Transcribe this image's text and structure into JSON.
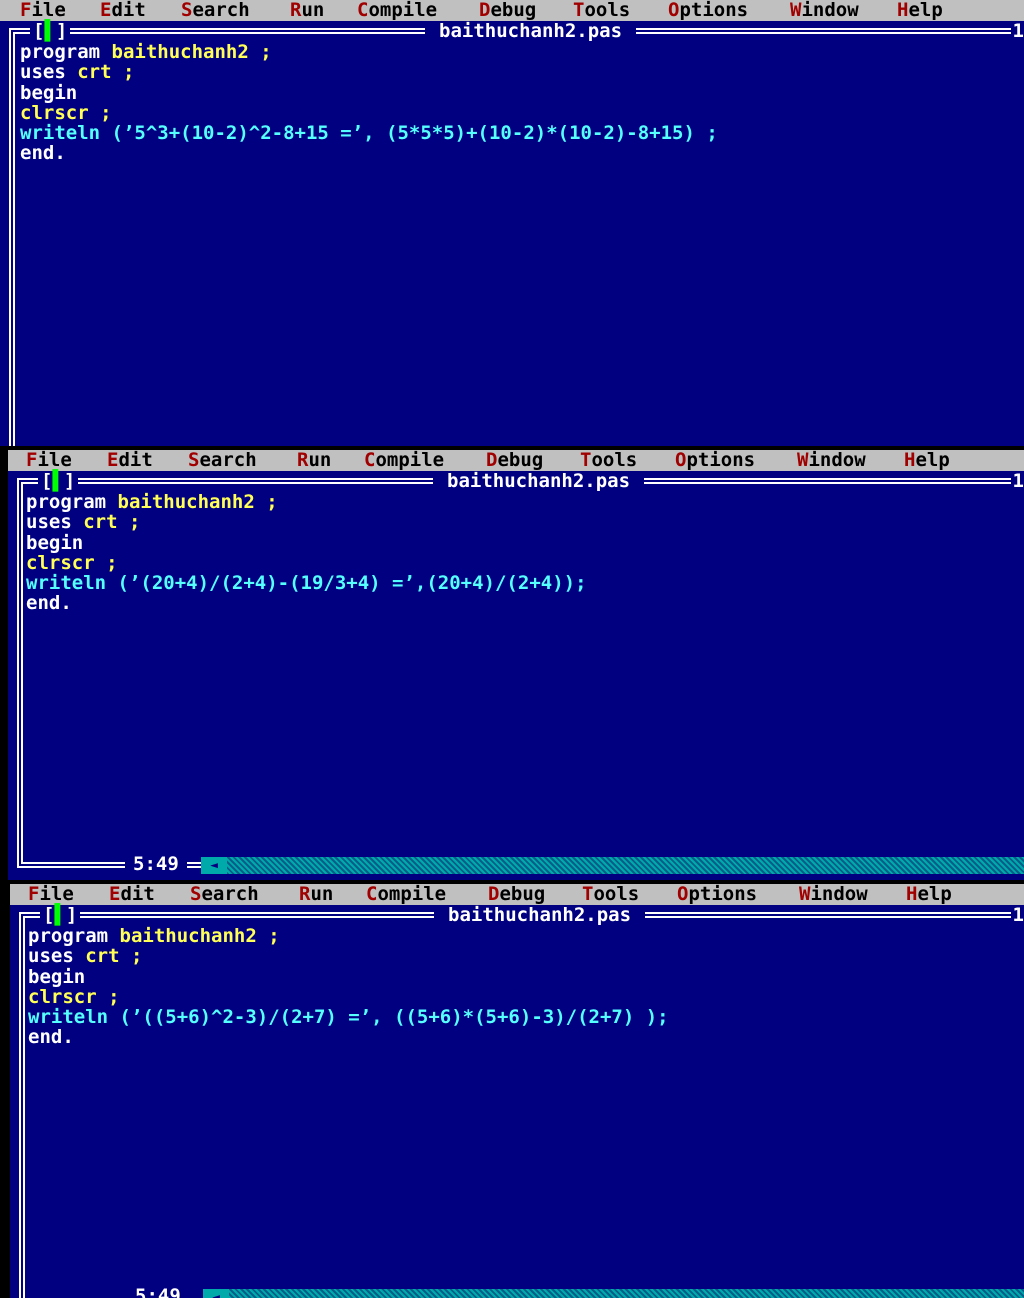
{
  "menu": [
    "File",
    "Edit",
    "Search",
    "Run",
    "Compile",
    "Debug",
    "Tools",
    "Options",
    "Window",
    "Help"
  ],
  "window": {
    "title": "baithuchanh2.pas",
    "number": "1",
    "close_box": "[",
    "close_mark": "▌",
    "close_box_end": "]",
    "cursor_position": "5:49",
    "scroll_arrow": "◄"
  },
  "program": {
    "line1_kw": "program",
    "line1_name": "baithuchanh2",
    "semicolon": ";",
    "line2_kw": "uses",
    "line2_unit": "crt",
    "begin": "begin",
    "clrscr": "clrscr",
    "end": "end."
  },
  "editors": [
    {
      "writeln": "writeln (’5^3+(10-2)^2-8+15 =’, (5*5*5)+(10-2)*(10-2)-8+15) ;"
    },
    {
      "writeln": "writeln (’(20+4)/(2+4)-(19/3+4) =’,(20+4)/(2+4));"
    },
    {
      "writeln": "writeln (’((5+6)^2-3)/(2+7) =’, ((5+6)*(5+6)-3)/(2+7) );"
    }
  ],
  "colors": {
    "editor_bg": "#000080",
    "menu_bg": "#c0c0c0",
    "hotkey": "#a00000",
    "keyword": "#ffffff",
    "identifier": "#ffff55",
    "string": "#55ffff",
    "number": "#00aaaa"
  }
}
